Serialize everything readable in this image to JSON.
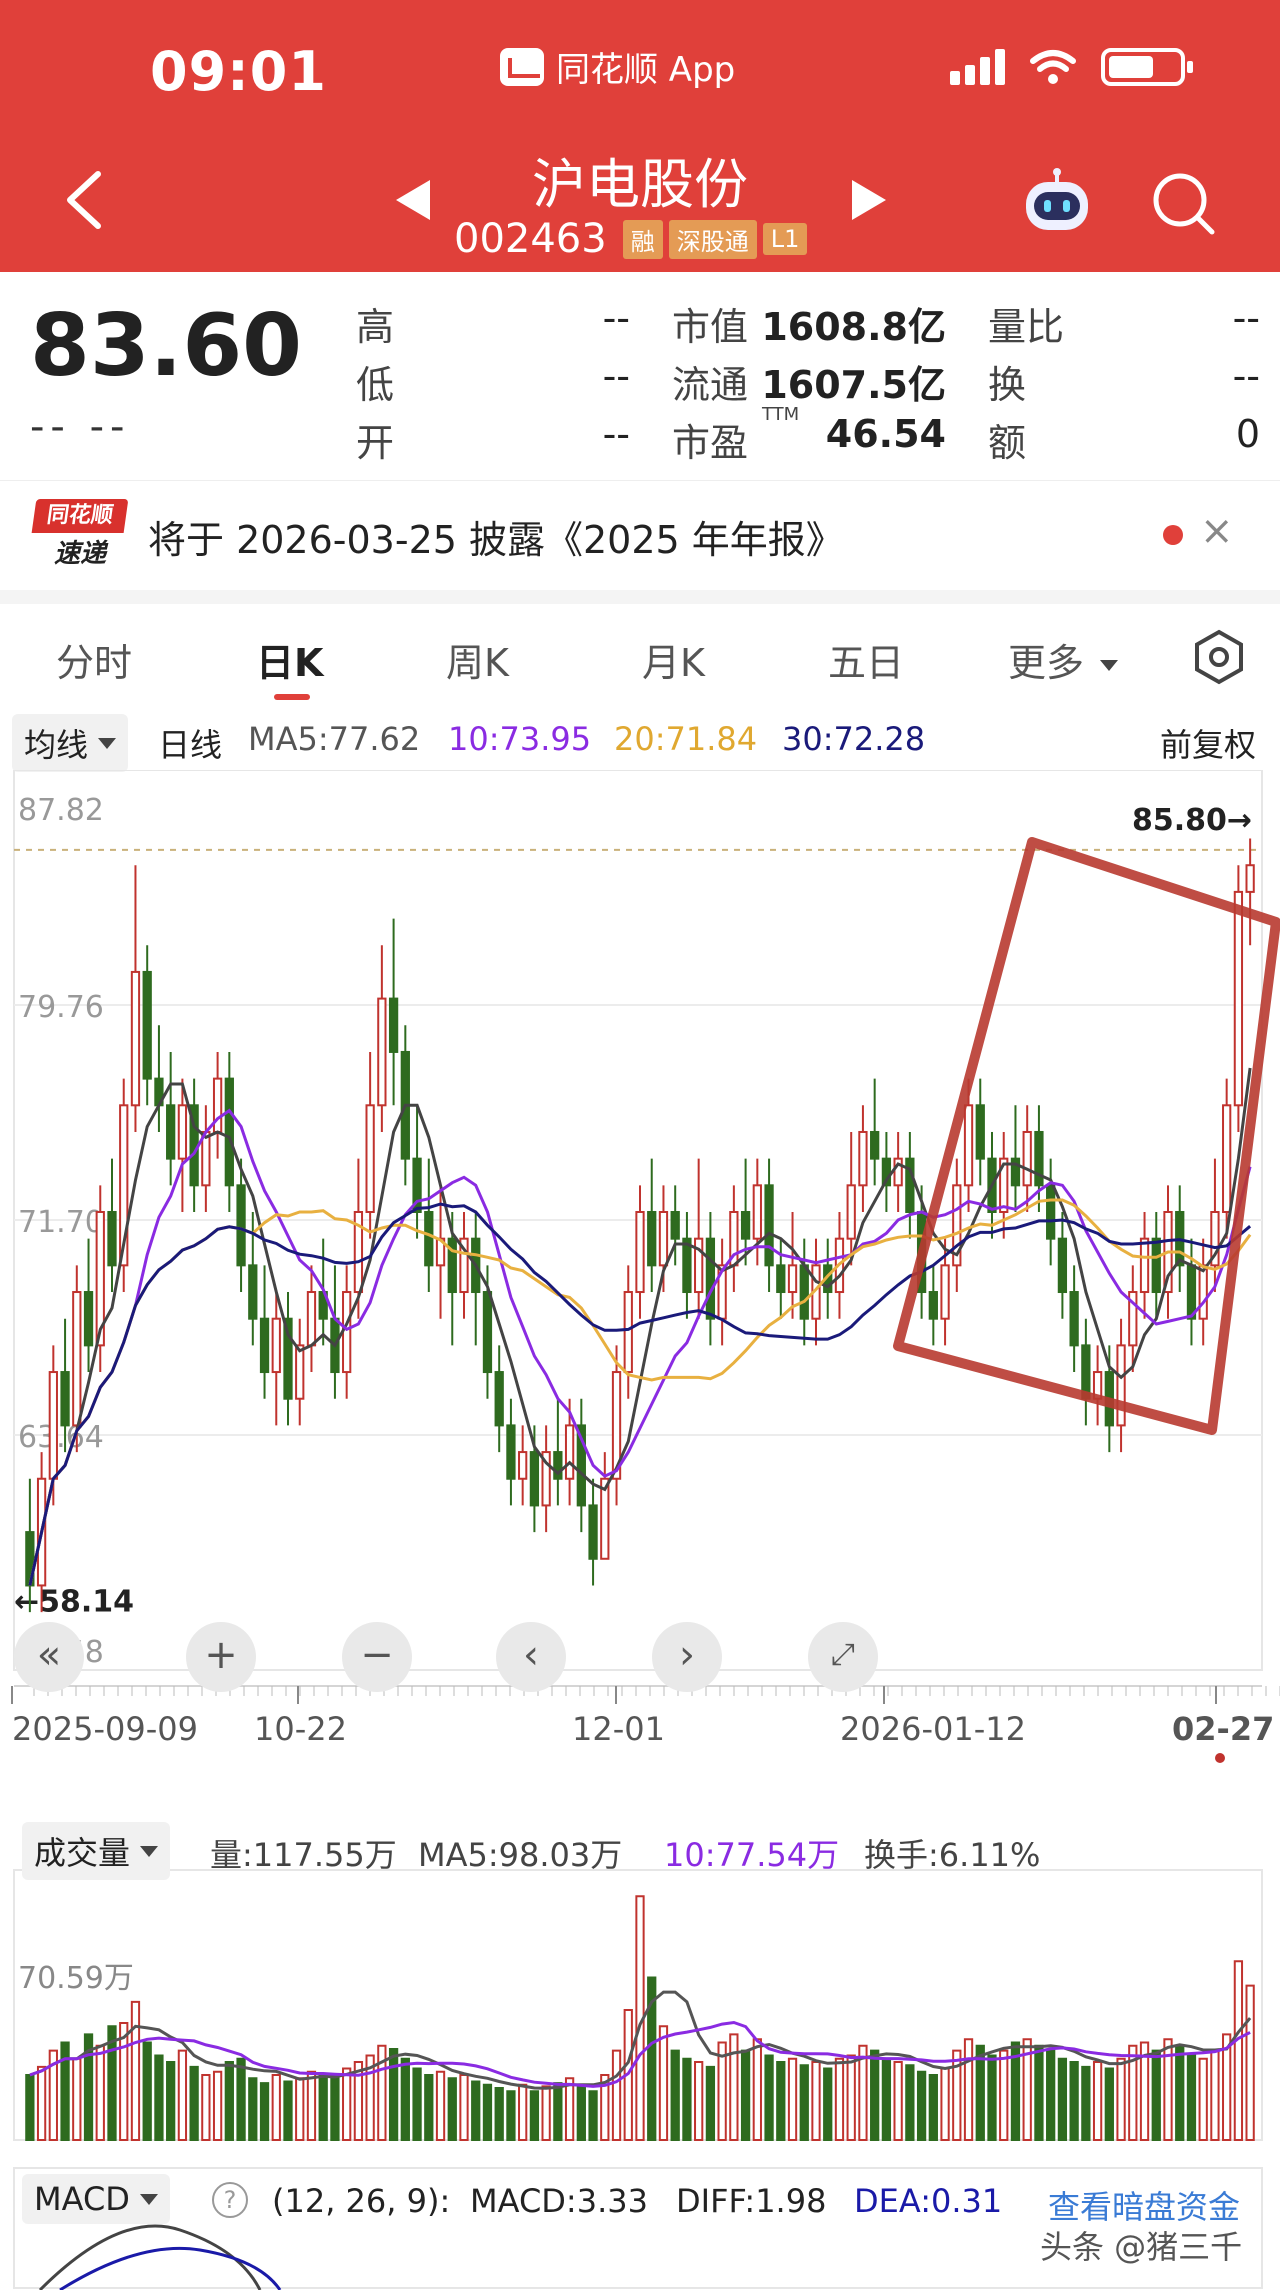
{
  "status_bar": {
    "time": "09:01",
    "app_name": "同花顺 App"
  },
  "header": {
    "title": "沪电股份",
    "code": "002463",
    "tags": [
      "融",
      "深股通",
      "L1"
    ]
  },
  "quote": {
    "price": "83.60",
    "change": "-- --",
    "rows": [
      {
        "label": "高",
        "value": "--",
        "label2": "市值",
        "value2": "1608.8亿",
        "label3": "量比",
        "value3": "--"
      },
      {
        "label": "低",
        "value": "--",
        "label2": "流通",
        "value2": "1607.5亿",
        "label3": "换",
        "value3": "--"
      },
      {
        "label": "开",
        "value": "--",
        "label2": "市盈",
        "ttm": "TTM",
        "value2": "46.54",
        "label3": "额",
        "value3": "0"
      }
    ]
  },
  "news": {
    "logo_top": "同花顺",
    "logo_bottom": "速递",
    "text": "将于 2026-03-25 披露《2025 年年报》",
    "close": "×"
  },
  "tabs": [
    "分时",
    "日K",
    "周K",
    "月K",
    "五日",
    "更多"
  ],
  "ma_bar": {
    "dropdown": "均线",
    "period": "日线",
    "ma5": "MA5:77.62",
    "ma10": "10:73.95",
    "ma20": "20:71.84",
    "ma30": "30:72.28",
    "adjust": "前复权"
  },
  "colors": {
    "up": "#c0332e",
    "down": "#2e6b1f",
    "ma5": "#444444",
    "ma10": "#8a2be2",
    "ma20": "#e8b040",
    "ma30": "#1a1a7a",
    "header": "#e0403a",
    "box": "#b83a30"
  },
  "chart_data": {
    "type": "candlestick",
    "price_axis_labels": [
      "87.82",
      "79.76",
      "71.70",
      "63.64",
      "55.58"
    ],
    "ylim": [
      55.58,
      87.82
    ],
    "max_label": "85.80→",
    "min_label": "←58.14",
    "x_tick_labels": [
      "2025-09-09",
      "10-22",
      "12-01",
      "2026-01-12",
      "02-27"
    ],
    "candles": [
      [
        60,
        58,
        62,
        57
      ],
      [
        58,
        62,
        63,
        57
      ],
      [
        62,
        66,
        67,
        61
      ],
      [
        66,
        64,
        68,
        63
      ],
      [
        64,
        69,
        70,
        63
      ],
      [
        69,
        67,
        71,
        66
      ],
      [
        67,
        72,
        73,
        66
      ],
      [
        72,
        70,
        74,
        69
      ],
      [
        70,
        76,
        77,
        69
      ],
      [
        76,
        81,
        85,
        75
      ],
      [
        81,
        77,
        82,
        76
      ],
      [
        77,
        76,
        79,
        75
      ],
      [
        76,
        74,
        78,
        73
      ],
      [
        74,
        76,
        77,
        72
      ],
      [
        76,
        73,
        77,
        72
      ],
      [
        73,
        75,
        76,
        72
      ],
      [
        75,
        77,
        78,
        74
      ],
      [
        77,
        73,
        78,
        72
      ],
      [
        73,
        70,
        74,
        69
      ],
      [
        70,
        68,
        72,
        67
      ],
      [
        68,
        66,
        70,
        65
      ],
      [
        66,
        68,
        69,
        64
      ],
      [
        68,
        65,
        69,
        64
      ],
      [
        65,
        67,
        68,
        64
      ],
      [
        67,
        69,
        70,
        66
      ],
      [
        69,
        68,
        71,
        67
      ],
      [
        68,
        66,
        70,
        65
      ],
      [
        66,
        69,
        70,
        65
      ],
      [
        69,
        72,
        74,
        68
      ],
      [
        72,
        76,
        78,
        71
      ],
      [
        76,
        80,
        82,
        75
      ],
      [
        80,
        78,
        83,
        76
      ],
      [
        78,
        74,
        79,
        73
      ],
      [
        74,
        72,
        76,
        71
      ],
      [
        72,
        70,
        74,
        69
      ],
      [
        70,
        71,
        73,
        68
      ],
      [
        71,
        69,
        72,
        67
      ],
      [
        69,
        71,
        72,
        68
      ],
      [
        71,
        69,
        72,
        67
      ],
      [
        69,
        66,
        70,
        65
      ],
      [
        66,
        64,
        67,
        63
      ],
      [
        64,
        62,
        65,
        61
      ],
      [
        62,
        63,
        64,
        61
      ],
      [
        63,
        61,
        64,
        60
      ],
      [
        61,
        63,
        64,
        60
      ],
      [
        63,
        62,
        65,
        61
      ],
      [
        62,
        64,
        65,
        61
      ],
      [
        64,
        61,
        65,
        60
      ],
      [
        61,
        59,
        62,
        58
      ],
      [
        59,
        62,
        63,
        59
      ],
      [
        62,
        66,
        67,
        61
      ],
      [
        66,
        69,
        70,
        65
      ],
      [
        69,
        72,
        73,
        68
      ],
      [
        72,
        70,
        74,
        69
      ],
      [
        70,
        72,
        73,
        69
      ],
      [
        72,
        71,
        73,
        70
      ],
      [
        71,
        69,
        72,
        68
      ],
      [
        69,
        71,
        74,
        68
      ],
      [
        71,
        68,
        72,
        67
      ],
      [
        68,
        70,
        71,
        67
      ],
      [
        70,
        72,
        73,
        69
      ],
      [
        72,
        71,
        74,
        70
      ],
      [
        71,
        73,
        74,
        70
      ],
      [
        73,
        70,
        74,
        69
      ],
      [
        70,
        69,
        71,
        68
      ],
      [
        69,
        70,
        72,
        68
      ],
      [
        70,
        68,
        71,
        67
      ],
      [
        68,
        70,
        71,
        67
      ],
      [
        70,
        69,
        71,
        68
      ],
      [
        69,
        71,
        72,
        68
      ],
      [
        71,
        73,
        75,
        70
      ],
      [
        73,
        75,
        76,
        72
      ],
      [
        75,
        74,
        77,
        73
      ],
      [
        74,
        73,
        75,
        72
      ],
      [
        73,
        74,
        75,
        72
      ],
      [
        74,
        72,
        75,
        71
      ],
      [
        72,
        69,
        73,
        68
      ],
      [
        69,
        68,
        70,
        67
      ],
      [
        68,
        70,
        71,
        67
      ],
      [
        70,
        73,
        74,
        69
      ],
      [
        73,
        76,
        77,
        72
      ],
      [
        76,
        74,
        77,
        73
      ],
      [
        74,
        72,
        75,
        71
      ],
      [
        72,
        74,
        75,
        71
      ],
      [
        74,
        73,
        76,
        72
      ],
      [
        73,
        75,
        76,
        72
      ],
      [
        75,
        73,
        76,
        72
      ],
      [
        73,
        71,
        74,
        70
      ],
      [
        71,
        69,
        72,
        68
      ],
      [
        69,
        67,
        70,
        66
      ],
      [
        67,
        65,
        68,
        64
      ],
      [
        65,
        66,
        67,
        64
      ],
      [
        66,
        64,
        67,
        63
      ],
      [
        64,
        67,
        68,
        63
      ],
      [
        67,
        69,
        70,
        66
      ],
      [
        69,
        71,
        72,
        68
      ],
      [
        71,
        69,
        72,
        68
      ],
      [
        69,
        72,
        73,
        68
      ],
      [
        72,
        70,
        73,
        69
      ],
      [
        70,
        68,
        71,
        67
      ],
      [
        68,
        70,
        71,
        67
      ],
      [
        70,
        72,
        74,
        69
      ],
      [
        72,
        76,
        77,
        71
      ],
      [
        76,
        84,
        85,
        75
      ],
      [
        84,
        85,
        86,
        82
      ]
    ],
    "volume_header": {
      "dropdown": "成交量",
      "vol": "量:117.55万",
      "ma5": "MA5:98.03万",
      "ma10": "10:77.54万",
      "turnover": "换手:6.11%"
    },
    "volume_axis_label": "70.59万",
    "volumes": [
      40,
      45,
      55,
      60,
      50,
      65,
      58,
      70,
      72,
      85,
      60,
      52,
      48,
      55,
      45,
      40,
      42,
      48,
      50,
      38,
      35,
      40,
      36,
      38,
      42,
      40,
      38,
      44,
      48,
      52,
      58,
      56,
      50,
      44,
      40,
      42,
      38,
      40,
      36,
      34,
      32,
      30,
      34,
      30,
      33,
      35,
      38,
      34,
      30,
      40,
      55,
      80,
      150,
      100,
      70,
      55,
      50,
      48,
      45,
      60,
      65,
      55,
      62,
      52,
      48,
      50,
      46,
      48,
      44,
      50,
      52,
      58,
      55,
      50,
      48,
      46,
      42,
      40,
      44,
      55,
      62,
      58,
      52,
      55,
      60,
      62,
      58,
      55,
      50,
      48,
      45,
      48,
      44,
      50,
      58,
      60,
      55,
      62,
      58,
      52,
      50,
      55,
      65,
      110,
      95
    ],
    "macd_header": {
      "dropdown": "MACD",
      "params": "(12, 26, 9):",
      "macd": "MACD:3.33",
      "diff": "DIFF:1.98",
      "dea": "DEA:0.31",
      "link": "查看暗盘资金"
    }
  },
  "watermark": "头条 @猪三千"
}
